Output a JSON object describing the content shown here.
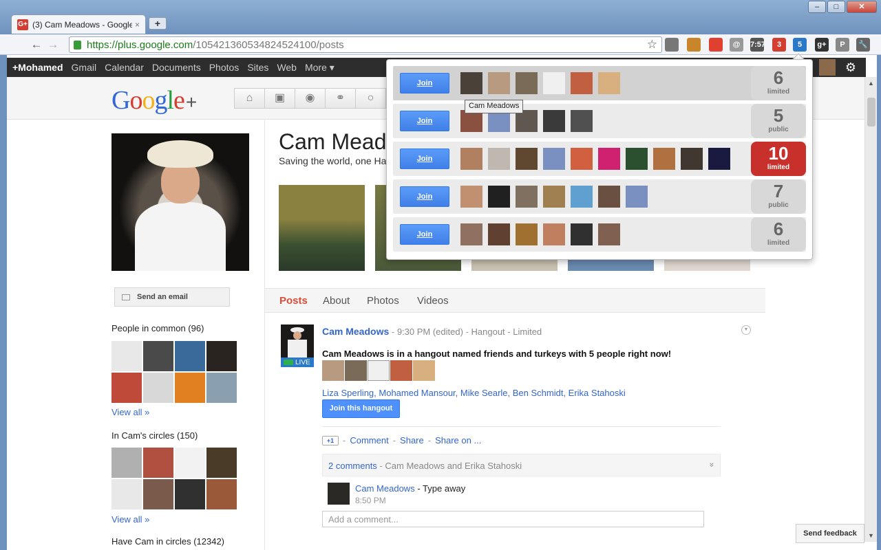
{
  "browser": {
    "tab_title": "(3) Cam Meadows - Google",
    "tab_close": "×",
    "new_tab": "+",
    "favicon": "G+",
    "url_host": "https://plus.google.com",
    "url_path": "/105421360534824524100/posts",
    "window_controls": {
      "minimize": "–",
      "maximize": "□",
      "close": "✕"
    },
    "extensions": [
      {
        "icon": "mic-icon",
        "label": "",
        "color": "#777777"
      },
      {
        "icon": "ext-notes-icon",
        "label": "",
        "color": "#c9852a"
      },
      {
        "icon": "ext-red-circle-icon",
        "label": "",
        "color": "#e04030"
      },
      {
        "icon": "ext-at-icon",
        "label": "@",
        "color": "#999999"
      },
      {
        "icon": "ext-printer-icon",
        "label": "7:57",
        "color": "#555555"
      },
      {
        "icon": "ext-notify-icon",
        "label": "3",
        "color": "#d23f31"
      },
      {
        "icon": "ext-hangout-icon",
        "label": "5",
        "color": "#2a78c8"
      },
      {
        "icon": "ext-gplus-icon",
        "label": "g+",
        "color": "#333333"
      },
      {
        "icon": "ext-p-icon",
        "label": "P",
        "color": "#888888"
      },
      {
        "icon": "wrench-icon",
        "label": "🔧",
        "color": "#666666"
      }
    ]
  },
  "gbar": {
    "items": [
      "+Mohamed",
      "Gmail",
      "Calendar",
      "Documents",
      "Photos",
      "Sites",
      "Web",
      "More ▾"
    ]
  },
  "header": {
    "nav_icons": [
      "home-icon",
      "photos-icon",
      "profile-icon",
      "circles-icon",
      "games-icon"
    ],
    "nav_glyphs": [
      "⌂",
      "▣",
      "◉",
      "⚭",
      "○"
    ],
    "plus_glyph": "+"
  },
  "profile": {
    "name": "Cam Meadows",
    "tagline": "Saving the world, one Ha",
    "send_email": "Send an email",
    "people_in_common": "People in common (96)",
    "in_circles": "In Cam's circles (150)",
    "have_in_circles": "Have Cam in circles (12342)",
    "view_all": "View all »",
    "tabs": [
      "Posts",
      "About",
      "Photos",
      "Videos"
    ]
  },
  "post": {
    "author": "Cam Meadows",
    "time": "9:30 PM (edited)",
    "type": "Hangout",
    "visibility": "Limited",
    "live": "LIVE",
    "body": "Cam Meadows is in a hangout named friends and turkeys with 5 people right now!",
    "participant_names": "Liza Sperling, Mohamed Mansour, Mike Searle, Ben Schmidt, Erika Stahoski",
    "join_label": "Join this hangout",
    "plus_one": "+1",
    "actions": [
      "Comment",
      "Share",
      "Share on ..."
    ],
    "comments_count": "2 comments",
    "comments_who": "Cam Meadows and Erika Stahoski",
    "comment": {
      "author": "Cam Meadows",
      "text": "Type away",
      "time": "8:50 PM"
    },
    "add_comment_placeholder": "Add a comment...",
    "menu_glyph": "▼",
    "expand_glyph": "»"
  },
  "feedback": "Send feedback",
  "popup": {
    "tooltip": "Cam Meadows",
    "join_label": "Join",
    "rows": [
      {
        "count": "6",
        "label": "limited",
        "hot": false,
        "avatars": [
          "#4a4238",
          "#b89a80",
          "#7a6a58",
          "#f0f0f0",
          "#c06040",
          "#d8b080"
        ]
      },
      {
        "count": "5",
        "label": "public",
        "hot": false,
        "avatars": [
          "#8a5040",
          "#7a90c0",
          "#605850",
          "#3a3a3a",
          "#505050"
        ]
      },
      {
        "count": "10",
        "label": "limited",
        "hot": true,
        "avatars": [
          "#b08060",
          "#c0b8b0",
          "#604830",
          "#7a90c0",
          "#d06040",
          "#d02070",
          "#2a5030",
          "#b07040",
          "#403830",
          "#1a1a40"
        ]
      },
      {
        "count": "7",
        "label": "public",
        "hot": false,
        "avatars": [
          "#c09070",
          "#202020",
          "#807060",
          "#a08050",
          "#60a0d0",
          "#6a5040",
          "#7a90c0"
        ]
      },
      {
        "count": "6",
        "label": "limited",
        "hot": false,
        "avatars": [
          "#907060",
          "#604030",
          "#a07030",
          "#c08060",
          "#303030",
          "#806050"
        ]
      }
    ]
  },
  "colors": {
    "google_red": "#dd4b39",
    "link_blue": "#3366cc",
    "join_blue": "#4d90fe"
  }
}
